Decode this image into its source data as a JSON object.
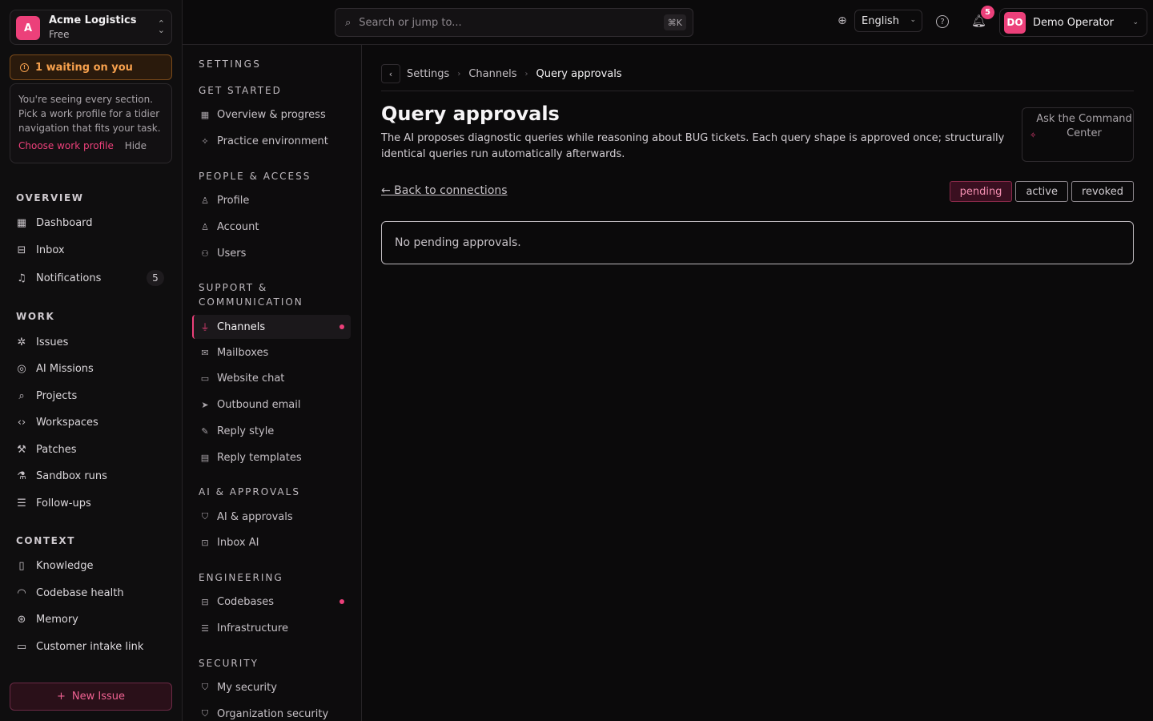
{
  "org": {
    "initial": "A",
    "name": "Acme Logistics",
    "plan": "Free"
  },
  "waiting": {
    "label": "1 waiting on you"
  },
  "profile_hint": {
    "text": "You're seeing every section. Pick a work profile for a tidier navigation that fits your task.",
    "choose": "Choose work profile",
    "hide": "Hide"
  },
  "sidebar": {
    "overview_title": "OVERVIEW",
    "work_title": "WORK",
    "context_title": "CONTEXT",
    "overview": [
      {
        "label": "Dashboard"
      },
      {
        "label": "Inbox"
      },
      {
        "label": "Notifications",
        "badge": "5"
      }
    ],
    "work": [
      {
        "label": "Issues"
      },
      {
        "label": "AI Missions"
      },
      {
        "label": "Projects"
      },
      {
        "label": "Workspaces"
      },
      {
        "label": "Patches"
      },
      {
        "label": "Sandbox runs"
      },
      {
        "label": "Follow-ups"
      }
    ],
    "context": [
      {
        "label": "Knowledge"
      },
      {
        "label": "Codebase health"
      },
      {
        "label": "Memory"
      },
      {
        "label": "Customer intake link"
      }
    ],
    "new_issue": "New Issue"
  },
  "topbar": {
    "search_placeholder": "Search or jump to...",
    "shortcut": "⌘K",
    "language": "English",
    "notif_count": "5",
    "user_initials": "DO",
    "user_name": "Demo Operator"
  },
  "settings_nav": {
    "title": "SETTINGS",
    "groups": [
      {
        "title": "GET STARTED",
        "items": [
          "Overview & progress",
          "Practice environment"
        ]
      },
      {
        "title": "PEOPLE & ACCESS",
        "items": [
          "Profile",
          "Account",
          "Users"
        ]
      },
      {
        "title_1": "SUPPORT &",
        "title_2": "COMMUNICATION",
        "items": [
          "Channels",
          "Mailboxes",
          "Website chat",
          "Outbound email",
          "Reply style",
          "Reply templates"
        ]
      },
      {
        "title": "AI & APPROVALS",
        "items": [
          "AI & approvals",
          "Inbox AI"
        ]
      },
      {
        "title": "ENGINEERING",
        "items": [
          "Codebases",
          "Infrastructure"
        ]
      },
      {
        "title": "SECURITY",
        "items": [
          "My security",
          "Organization security"
        ]
      }
    ]
  },
  "breadcrumb": [
    "Settings",
    "Channels",
    "Query approvals"
  ],
  "page": {
    "title": "Query approvals",
    "description": "The AI proposes diagnostic queries while reasoning about BUG tickets. Each query shape is approved once; structurally identical queries run automatically afterwards.",
    "ask": "Ask the Command Center",
    "back_link": "← Back to connections",
    "filters": [
      "pending",
      "active",
      "revoked"
    ],
    "empty": "No pending approvals."
  },
  "colors": {
    "accent": "#ec407a",
    "warning": "#f6a04d",
    "background": "#0b0a0b"
  }
}
